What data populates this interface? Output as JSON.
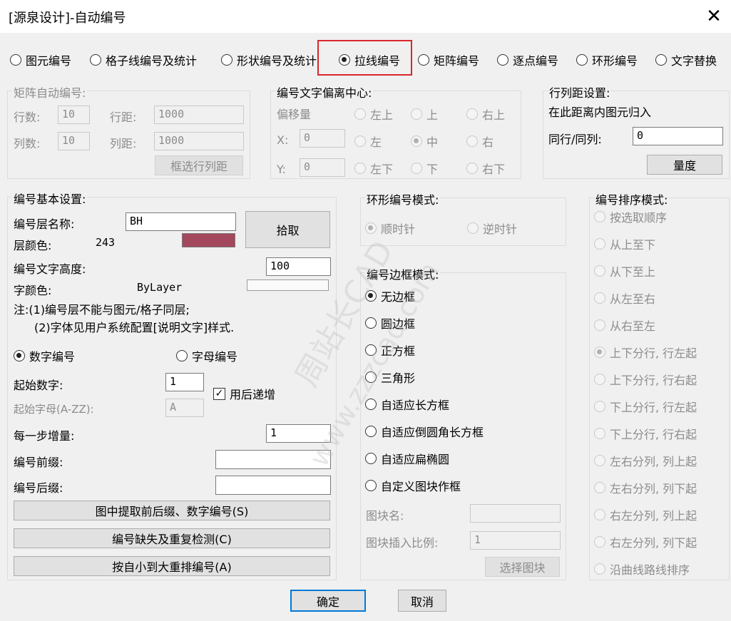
{
  "window": {
    "title": "[源泉设计]-自动编号",
    "close_icon": "close-icon"
  },
  "top_tabs": [
    {
      "label": "图元编号",
      "checked": false
    },
    {
      "label": "格子线编号及统计",
      "checked": false
    },
    {
      "label": "形状编号及统计",
      "checked": false
    },
    {
      "label": "拉线编号",
      "checked": true
    },
    {
      "label": "矩阵编号",
      "checked": false
    },
    {
      "label": "逐点编号",
      "checked": false
    },
    {
      "label": "环形编号",
      "checked": false
    },
    {
      "label": "文字替换",
      "checked": false
    }
  ],
  "matrix": {
    "title": "矩阵自动编号:",
    "rows_label": "行数:",
    "rows_value": "10",
    "row_gap_label": "行距:",
    "row_gap_value": "1000",
    "cols_label": "列数:",
    "cols_value": "10",
    "col_gap_label": "列距:",
    "col_gap_value": "1000",
    "select_button": "框选行列距"
  },
  "offset": {
    "title": "编号文字偏离中心:",
    "offset_label": "偏移量",
    "x_label": "X:",
    "x_value": "0",
    "y_label": "Y:",
    "y_value": "0",
    "positions": [
      "左上",
      "上",
      "右上",
      "左",
      "中",
      "右",
      "左下",
      "下",
      "右下"
    ],
    "selected": "中"
  },
  "rowcol": {
    "title": "行列距设置:",
    "desc": "在此距离内图元归入",
    "same_label": "同行/同列:",
    "same_value": "0",
    "measure_button": "量度"
  },
  "basic": {
    "title": "编号基本设置:",
    "layer_name_label": "编号层名称:",
    "layer_name_value": "BH",
    "layer_color_label": "层颜色:",
    "layer_color_value": "243",
    "layer_color_hex": "#a3485d",
    "pick_button": "拾取",
    "text_height_label": "编号文字高度:",
    "text_height_value": "100",
    "font_color_label": "字颜色:",
    "font_color_value": "ByLayer",
    "note1": "注:(1)编号层不能与图元/格子同层;",
    "note2": "(2)字体见用户系统配置[说明文字]样式.",
    "numeric_label": "数字编号",
    "alpha_label": "字母编号",
    "start_num_label": "起始数字:",
    "start_num_value": "1",
    "auto_inc_label": "用后递增",
    "start_alpha_label": "起始字母(A-ZZ):",
    "start_alpha_value": "A",
    "step_label": "每一步增量:",
    "step_value": "1",
    "prefix_label": "编号前缀:",
    "prefix_value": "",
    "suffix_label": "编号后缀:",
    "suffix_value": "",
    "extract_button": "图中提取前后缀、数字编号(S)",
    "check_button": "编号缺失及重复检测(C)",
    "renumber_button": "按自小到大重排编号(A)"
  },
  "ring": {
    "title": "环形编号模式:",
    "cw": "顺时针",
    "ccw": "逆时针"
  },
  "border": {
    "title": "编号边框模式:",
    "options": [
      "无边框",
      "圆边框",
      "正方框",
      "三角形",
      "自适应长方框",
      "自适应倒圆角长方框",
      "自适应扁椭圆",
      "自定义图块作框"
    ],
    "selected": "无边框",
    "block_name_label": "图块名:",
    "block_name_value": "",
    "block_scale_label": "图块插入比例:",
    "block_scale_value": "1",
    "select_block_button": "选择图块"
  },
  "sort": {
    "title": "编号排序模式:",
    "options": [
      "按选取顺序",
      "从上至下",
      "从下至上",
      "从左至右",
      "从右至左",
      "上下分行, 行左起",
      "上下分行, 行右起",
      "下上分行, 行左起",
      "下上分行, 行右起",
      "左右分列, 列上起",
      "左右分列, 列下起",
      "右左分列, 列上起",
      "右左分列, 列下起",
      "沿曲线路线排序"
    ],
    "selected": "上下分行, 行左起"
  },
  "footer": {
    "ok": "确定",
    "cancel": "取消"
  },
  "watermark": {
    "line1": "周站长CAD",
    "line2": "www.zzzcad.com"
  }
}
